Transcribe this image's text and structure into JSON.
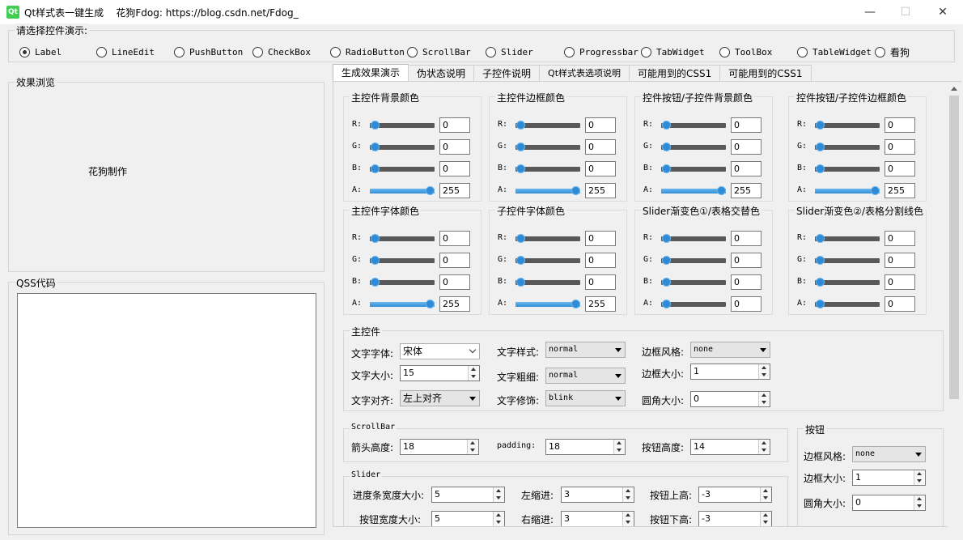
{
  "window": {
    "title": "Qt样式表一键生成    花狗Fdog: https://blog.csdn.net/Fdog_",
    "logo": "Qt",
    "minimize": "—",
    "maximize": "☐",
    "close": "✕"
  },
  "demo_select": {
    "label": "请选择控件演示:",
    "options": [
      "Label",
      "LineEdit",
      "PushButton",
      "CheckBox",
      "RadioButton",
      "ScrollBar",
      "Slider",
      "Progressbar",
      "TabWidget",
      "ToolBox",
      "TableWidget",
      "看狗"
    ],
    "selected": "Label"
  },
  "preview": {
    "label": "效果浏览",
    "text": "花狗制作"
  },
  "qss": {
    "label": "QSS代码",
    "value": ""
  },
  "tabs": [
    "生成效果演示",
    "伪状态说明",
    "子控件说明",
    "Qt样式表选项说明",
    "可能用到的CSS1",
    "可能用到的CSS1"
  ],
  "active_tab": "生成效果演示",
  "color_groups": [
    {
      "title": "主控件背景颜色",
      "values": [
        "0",
        "0",
        "0",
        "255"
      ],
      "levels": [
        0,
        0,
        0,
        1
      ]
    },
    {
      "title": "主控件边框颜色",
      "values": [
        "0",
        "0",
        "0",
        "255"
      ],
      "levels": [
        0,
        0,
        0,
        1
      ]
    },
    {
      "title": "控件按钮/子控件背景颜色",
      "values": [
        "0",
        "0",
        "0",
        "255"
      ],
      "levels": [
        0,
        0,
        0,
        1
      ]
    },
    {
      "title": "控件按钮/子控件边框颜色",
      "values": [
        "0",
        "0",
        "0",
        "255"
      ],
      "levels": [
        0,
        0,
        0,
        1
      ]
    },
    {
      "title": "主控件字体颜色",
      "values": [
        "0",
        "0",
        "0",
        "255"
      ],
      "levels": [
        0,
        0,
        0,
        1
      ]
    },
    {
      "title": "子控件字体颜色",
      "values": [
        "0",
        "0",
        "0",
        "255"
      ],
      "levels": [
        0,
        0,
        0,
        1
      ]
    },
    {
      "title": "Slider渐变色①/表格交替色",
      "values": [
        "0",
        "0",
        "0",
        "0"
      ],
      "levels": [
        0,
        0,
        0,
        0
      ]
    },
    {
      "title": "Slider渐变色②/表格分割线色",
      "values": [
        "0",
        "0",
        "0",
        "0"
      ],
      "levels": [
        0,
        0,
        0,
        0
      ]
    }
  ],
  "channels": [
    "R:",
    "G:",
    "B:",
    "A:"
  ],
  "main": {
    "title": "主控件",
    "font_label": "文字字体:",
    "font_value": "宋体",
    "size_label": "文字大小:",
    "size_value": "15",
    "align_label": "文字对齐:",
    "align_value": "左上对齐",
    "style_label": "文字样式:",
    "style_value": "normal",
    "weight_label": "文字粗细:",
    "weight_value": "normal",
    "decor_label": "文字修饰:",
    "decor_value": "blink",
    "border_style_label": "边框风格:",
    "border_style_value": "none",
    "border_size_label": "边框大小:",
    "border_size_value": "1",
    "radius_label": "圆角大小:",
    "radius_value": "0"
  },
  "scrollbar": {
    "title": "ScrollBar",
    "arrow_label": "箭头高度:",
    "arrow_value": "18",
    "padding_label": "padding:",
    "padding_value": "18",
    "btn_label": "按钮高度:",
    "btn_value": "14"
  },
  "button": {
    "title": "按钮",
    "border_style_label": "边框风格:",
    "border_style_value": "none",
    "border_size_label": "边框大小:",
    "border_size_value": "1",
    "radius_label": "圆角大小:",
    "radius_value": "0"
  },
  "slider": {
    "title": "Slider",
    "bar_width_label": "进度条宽度大小:",
    "bar_width_value": "5",
    "left_label": "左缩进:",
    "left_value": "3",
    "btn_top_label": "按钮上高:",
    "btn_top_value": "-3",
    "btn_width_label": "按钮宽度大小:",
    "btn_width_value": "5",
    "right_label": "右缩进:",
    "right_value": "3",
    "btn_bottom_label": "按钮下高:",
    "btn_bottom_value": "-3"
  },
  "colors": {
    "accent": "#2f8bd6",
    "track": "#595959",
    "qt_green": "#41cd52"
  }
}
